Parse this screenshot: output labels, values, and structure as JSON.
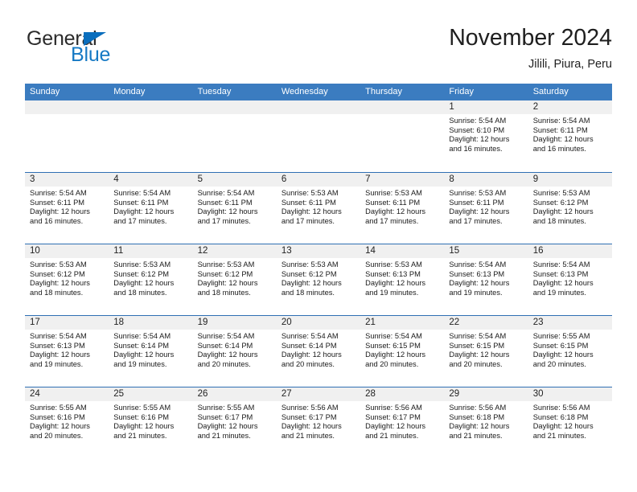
{
  "brand": {
    "name_part1": "General",
    "name_part2": "Blue",
    "color_blue": "#1679c4",
    "color_dark": "#2b2b2b"
  },
  "header": {
    "title": "November 2024",
    "subtitle": "Jilili, Piura, Peru"
  },
  "theme": {
    "header_row_bg": "#3b7cc0",
    "day_band_bg": "#f0f0f0",
    "row_divider": "#2f6fb3"
  },
  "weekdays": [
    "Sunday",
    "Monday",
    "Tuesday",
    "Wednesday",
    "Thursday",
    "Friday",
    "Saturday"
  ],
  "labels": {
    "sunrise": "Sunrise:",
    "sunset": "Sunset:",
    "daylight": "Daylight:"
  },
  "weeks": [
    [
      {
        "day": "",
        "sunrise": "",
        "sunset": "",
        "daylight_l1": "",
        "daylight_l2": ""
      },
      {
        "day": "",
        "sunrise": "",
        "sunset": "",
        "daylight_l1": "",
        "daylight_l2": ""
      },
      {
        "day": "",
        "sunrise": "",
        "sunset": "",
        "daylight_l1": "",
        "daylight_l2": ""
      },
      {
        "day": "",
        "sunrise": "",
        "sunset": "",
        "daylight_l1": "",
        "daylight_l2": ""
      },
      {
        "day": "",
        "sunrise": "",
        "sunset": "",
        "daylight_l1": "",
        "daylight_l2": ""
      },
      {
        "day": "1",
        "sunrise": "Sunrise: 5:54 AM",
        "sunset": "Sunset: 6:10 PM",
        "daylight_l1": "Daylight: 12 hours",
        "daylight_l2": "and 16 minutes."
      },
      {
        "day": "2",
        "sunrise": "Sunrise: 5:54 AM",
        "sunset": "Sunset: 6:11 PM",
        "daylight_l1": "Daylight: 12 hours",
        "daylight_l2": "and 16 minutes."
      }
    ],
    [
      {
        "day": "3",
        "sunrise": "Sunrise: 5:54 AM",
        "sunset": "Sunset: 6:11 PM",
        "daylight_l1": "Daylight: 12 hours",
        "daylight_l2": "and 16 minutes."
      },
      {
        "day": "4",
        "sunrise": "Sunrise: 5:54 AM",
        "sunset": "Sunset: 6:11 PM",
        "daylight_l1": "Daylight: 12 hours",
        "daylight_l2": "and 17 minutes."
      },
      {
        "day": "5",
        "sunrise": "Sunrise: 5:54 AM",
        "sunset": "Sunset: 6:11 PM",
        "daylight_l1": "Daylight: 12 hours",
        "daylight_l2": "and 17 minutes."
      },
      {
        "day": "6",
        "sunrise": "Sunrise: 5:53 AM",
        "sunset": "Sunset: 6:11 PM",
        "daylight_l1": "Daylight: 12 hours",
        "daylight_l2": "and 17 minutes."
      },
      {
        "day": "7",
        "sunrise": "Sunrise: 5:53 AM",
        "sunset": "Sunset: 6:11 PM",
        "daylight_l1": "Daylight: 12 hours",
        "daylight_l2": "and 17 minutes."
      },
      {
        "day": "8",
        "sunrise": "Sunrise: 5:53 AM",
        "sunset": "Sunset: 6:11 PM",
        "daylight_l1": "Daylight: 12 hours",
        "daylight_l2": "and 17 minutes."
      },
      {
        "day": "9",
        "sunrise": "Sunrise: 5:53 AM",
        "sunset": "Sunset: 6:12 PM",
        "daylight_l1": "Daylight: 12 hours",
        "daylight_l2": "and 18 minutes."
      }
    ],
    [
      {
        "day": "10",
        "sunrise": "Sunrise: 5:53 AM",
        "sunset": "Sunset: 6:12 PM",
        "daylight_l1": "Daylight: 12 hours",
        "daylight_l2": "and 18 minutes."
      },
      {
        "day": "11",
        "sunrise": "Sunrise: 5:53 AM",
        "sunset": "Sunset: 6:12 PM",
        "daylight_l1": "Daylight: 12 hours",
        "daylight_l2": "and 18 minutes."
      },
      {
        "day": "12",
        "sunrise": "Sunrise: 5:53 AM",
        "sunset": "Sunset: 6:12 PM",
        "daylight_l1": "Daylight: 12 hours",
        "daylight_l2": "and 18 minutes."
      },
      {
        "day": "13",
        "sunrise": "Sunrise: 5:53 AM",
        "sunset": "Sunset: 6:12 PM",
        "daylight_l1": "Daylight: 12 hours",
        "daylight_l2": "and 18 minutes."
      },
      {
        "day": "14",
        "sunrise": "Sunrise: 5:53 AM",
        "sunset": "Sunset: 6:13 PM",
        "daylight_l1": "Daylight: 12 hours",
        "daylight_l2": "and 19 minutes."
      },
      {
        "day": "15",
        "sunrise": "Sunrise: 5:54 AM",
        "sunset": "Sunset: 6:13 PM",
        "daylight_l1": "Daylight: 12 hours",
        "daylight_l2": "and 19 minutes."
      },
      {
        "day": "16",
        "sunrise": "Sunrise: 5:54 AM",
        "sunset": "Sunset: 6:13 PM",
        "daylight_l1": "Daylight: 12 hours",
        "daylight_l2": "and 19 minutes."
      }
    ],
    [
      {
        "day": "17",
        "sunrise": "Sunrise: 5:54 AM",
        "sunset": "Sunset: 6:13 PM",
        "daylight_l1": "Daylight: 12 hours",
        "daylight_l2": "and 19 minutes."
      },
      {
        "day": "18",
        "sunrise": "Sunrise: 5:54 AM",
        "sunset": "Sunset: 6:14 PM",
        "daylight_l1": "Daylight: 12 hours",
        "daylight_l2": "and 19 minutes."
      },
      {
        "day": "19",
        "sunrise": "Sunrise: 5:54 AM",
        "sunset": "Sunset: 6:14 PM",
        "daylight_l1": "Daylight: 12 hours",
        "daylight_l2": "and 20 minutes."
      },
      {
        "day": "20",
        "sunrise": "Sunrise: 5:54 AM",
        "sunset": "Sunset: 6:14 PM",
        "daylight_l1": "Daylight: 12 hours",
        "daylight_l2": "and 20 minutes."
      },
      {
        "day": "21",
        "sunrise": "Sunrise: 5:54 AM",
        "sunset": "Sunset: 6:15 PM",
        "daylight_l1": "Daylight: 12 hours",
        "daylight_l2": "and 20 minutes."
      },
      {
        "day": "22",
        "sunrise": "Sunrise: 5:54 AM",
        "sunset": "Sunset: 6:15 PM",
        "daylight_l1": "Daylight: 12 hours",
        "daylight_l2": "and 20 minutes."
      },
      {
        "day": "23",
        "sunrise": "Sunrise: 5:55 AM",
        "sunset": "Sunset: 6:15 PM",
        "daylight_l1": "Daylight: 12 hours",
        "daylight_l2": "and 20 minutes."
      }
    ],
    [
      {
        "day": "24",
        "sunrise": "Sunrise: 5:55 AM",
        "sunset": "Sunset: 6:16 PM",
        "daylight_l1": "Daylight: 12 hours",
        "daylight_l2": "and 20 minutes."
      },
      {
        "day": "25",
        "sunrise": "Sunrise: 5:55 AM",
        "sunset": "Sunset: 6:16 PM",
        "daylight_l1": "Daylight: 12 hours",
        "daylight_l2": "and 21 minutes."
      },
      {
        "day": "26",
        "sunrise": "Sunrise: 5:55 AM",
        "sunset": "Sunset: 6:17 PM",
        "daylight_l1": "Daylight: 12 hours",
        "daylight_l2": "and 21 minutes."
      },
      {
        "day": "27",
        "sunrise": "Sunrise: 5:56 AM",
        "sunset": "Sunset: 6:17 PM",
        "daylight_l1": "Daylight: 12 hours",
        "daylight_l2": "and 21 minutes."
      },
      {
        "day": "28",
        "sunrise": "Sunrise: 5:56 AM",
        "sunset": "Sunset: 6:17 PM",
        "daylight_l1": "Daylight: 12 hours",
        "daylight_l2": "and 21 minutes."
      },
      {
        "day": "29",
        "sunrise": "Sunrise: 5:56 AM",
        "sunset": "Sunset: 6:18 PM",
        "daylight_l1": "Daylight: 12 hours",
        "daylight_l2": "and 21 minutes."
      },
      {
        "day": "30",
        "sunrise": "Sunrise: 5:56 AM",
        "sunset": "Sunset: 6:18 PM",
        "daylight_l1": "Daylight: 12 hours",
        "daylight_l2": "and 21 minutes."
      }
    ]
  ]
}
